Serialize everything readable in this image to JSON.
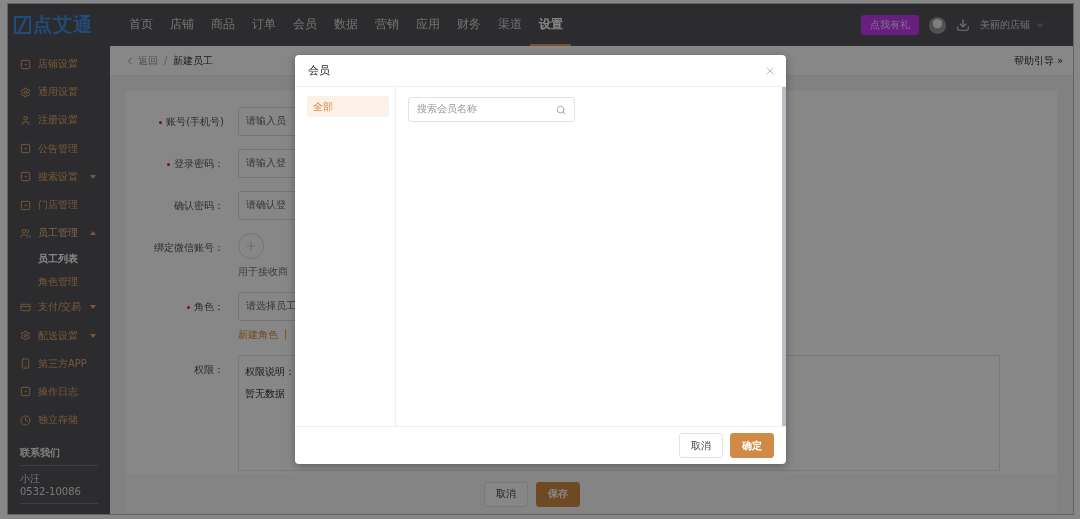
{
  "topbar": {
    "logo": "点艾通",
    "nav": [
      {
        "label": "首页",
        "selected": false
      },
      {
        "label": "店铺",
        "selected": false
      },
      {
        "label": "商品",
        "selected": false
      },
      {
        "label": "订单",
        "selected": false
      },
      {
        "label": "会员",
        "selected": false
      },
      {
        "label": "数据",
        "selected": false
      },
      {
        "label": "营销",
        "selected": false
      },
      {
        "label": "应用",
        "selected": false
      },
      {
        "label": "财务",
        "selected": false
      },
      {
        "label": "渠道",
        "selected": false
      },
      {
        "label": "设置",
        "selected": true
      }
    ],
    "gift_button": "点我有礼",
    "store": "美丽的店铺"
  },
  "sidebar": {
    "items": [
      {
        "label": "店铺设置"
      },
      {
        "label": "通用设置"
      },
      {
        "label": "注册设置"
      },
      {
        "label": "公告管理"
      },
      {
        "label": "搜索设置",
        "expanded": false
      },
      {
        "label": "门店管理"
      },
      {
        "label": "员工管理",
        "expanded": true,
        "children": [
          {
            "label": "员工列表",
            "selected": true
          },
          {
            "label": "角色管理",
            "selected": false
          }
        ]
      },
      {
        "label": "支付/交易",
        "expanded": false
      },
      {
        "label": "配送设置",
        "expanded": false
      },
      {
        "label": "第三方APP"
      },
      {
        "label": "操作日志"
      },
      {
        "label": "独立存储"
      }
    ],
    "contact": {
      "title": "联系我们",
      "name": "小汪",
      "phone": "0532-10086"
    }
  },
  "breadcrumb": {
    "back": "返回",
    "separator": "/",
    "current": "新建员工",
    "help": "帮助引导 »"
  },
  "form": {
    "fields": [
      {
        "kind": "input",
        "label": "账号(手机号)",
        "required": true,
        "placeholder": "请输入员"
      },
      {
        "kind": "input",
        "label": "登录密码：",
        "required": true,
        "placeholder": "请输入登"
      },
      {
        "kind": "input",
        "label": "确认密码：",
        "required": false,
        "placeholder": "请确认登"
      },
      {
        "kind": "upload",
        "label": "绑定微信账号：",
        "required": false,
        "hint": "用于接收商"
      },
      {
        "kind": "select",
        "label": "角色：",
        "required": true,
        "placeholder": "请选择员工",
        "links": [
          "新建角色",
          "|"
        ]
      },
      {
        "kind": "permissions",
        "label": "权限：",
        "required": false,
        "lines": [
          "权限说明：",
          "暂无数据"
        ]
      }
    ],
    "buttons": [
      {
        "label": "取消",
        "primary": false
      },
      {
        "label": "保存",
        "primary": true
      }
    ]
  },
  "dialog": {
    "title": "会员",
    "groups": [
      {
        "label": "全部",
        "selected": true
      }
    ],
    "search": {
      "placeholder": "搜索会员名称"
    },
    "buttons": [
      {
        "label": "取消",
        "primary": false
      },
      {
        "label": "确定",
        "primary": true
      }
    ]
  }
}
